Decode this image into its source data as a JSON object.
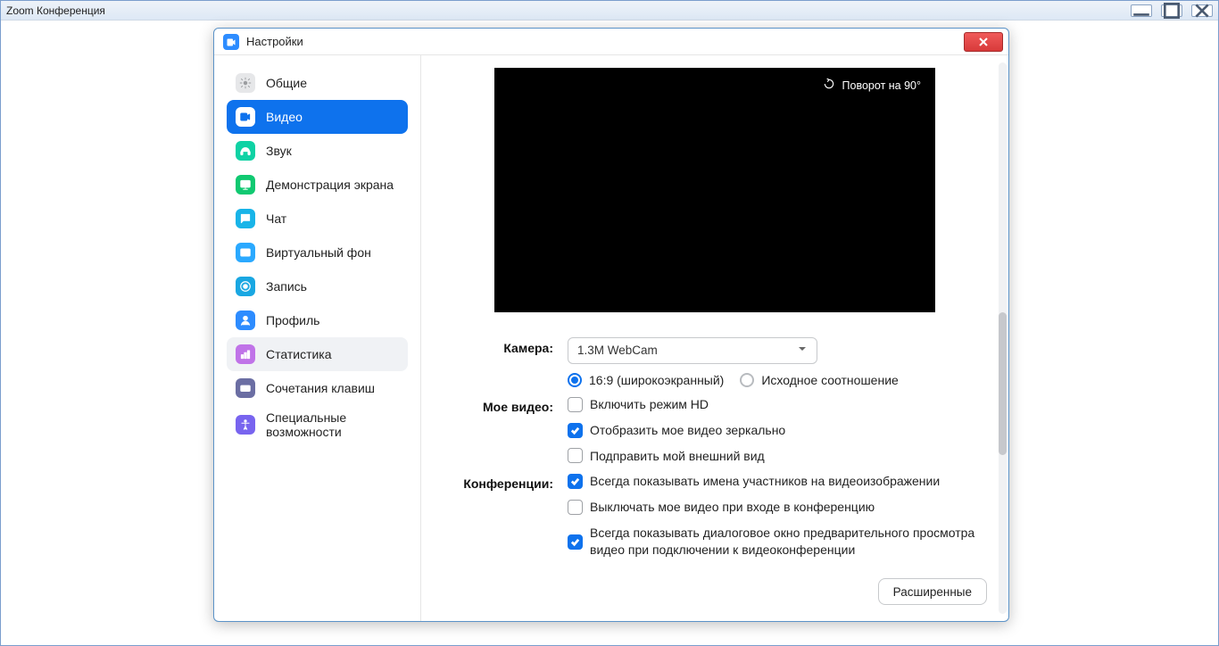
{
  "outer_window": {
    "title": "Zoom Конференция"
  },
  "dialog": {
    "title": "Настройки"
  },
  "sidebar": {
    "items": [
      {
        "id": "general",
        "label": "Общие",
        "bg": "#e6e7e9",
        "fg": "#9b9da0",
        "active": false,
        "hover": false
      },
      {
        "id": "video",
        "label": "Видео",
        "bg": "#0e72ed",
        "fg": "#ffffff",
        "active": true,
        "hover": false
      },
      {
        "id": "audio",
        "label": "Звук",
        "bg": "#0fd2a4",
        "fg": "#ffffff",
        "active": false,
        "hover": false
      },
      {
        "id": "share",
        "label": "Демонстрация экрана",
        "bg": "#10c971",
        "fg": "#ffffff",
        "active": false,
        "hover": false
      },
      {
        "id": "chat",
        "label": "Чат",
        "bg": "#18b4e8",
        "fg": "#ffffff",
        "active": false,
        "hover": false
      },
      {
        "id": "vbg",
        "label": "Виртуальный фон",
        "bg": "#2aa9ff",
        "fg": "#ffffff",
        "active": false,
        "hover": false
      },
      {
        "id": "recording",
        "label": "Запись",
        "bg": "#19a7e2",
        "fg": "#ffffff",
        "active": false,
        "hover": false
      },
      {
        "id": "profile",
        "label": "Профиль",
        "bg": "#2d8cff",
        "fg": "#ffffff",
        "active": false,
        "hover": false
      },
      {
        "id": "stats",
        "label": "Статистика",
        "bg": "#c073e8",
        "fg": "#ffffff",
        "active": false,
        "hover": true
      },
      {
        "id": "shortcuts",
        "label": "Сочетания клавиш",
        "bg": "#6b6ea3",
        "fg": "#ffffff",
        "active": false,
        "hover": false
      },
      {
        "id": "accessibility",
        "label": "Специальные возможности",
        "bg": "#7864ef",
        "fg": "#ffffff",
        "active": false,
        "hover": false
      }
    ]
  },
  "video": {
    "rotate_label": "Поворот на 90°",
    "camera_label": "Камера:",
    "camera_selected": "1.3M WebCam",
    "aspect_16_9": "16:9 (широкоэкранный)",
    "aspect_original": "Исходное соотношение",
    "myvideo_label": "Мое видео:",
    "hd": "Включить режим HD",
    "mirror": "Отобразить мое видео зеркально",
    "touchup": "Подправить мой внешний вид",
    "meetings_label": "Конференции:",
    "show_names": "Всегда показывать имена участников на видеоизображении",
    "mute_video_on_join": "Выключать мое видео при входе в конференцию",
    "preview_dialog": "Всегда показывать диалоговое окно предварительного просмотра видео при подключении к видеоконференции",
    "advanced": "Расширенные"
  }
}
